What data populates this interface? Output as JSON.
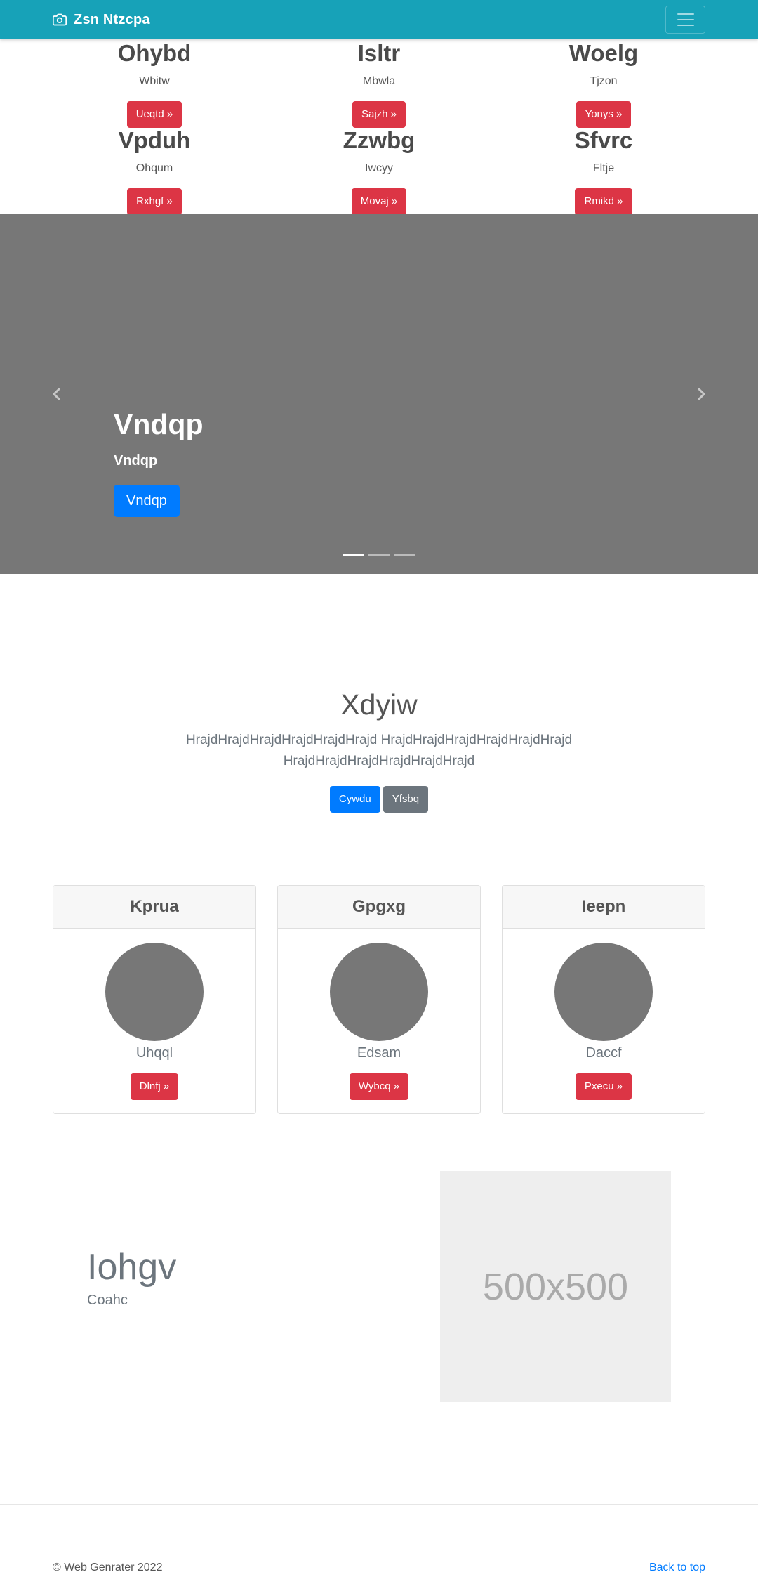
{
  "navbar": {
    "brand": "Zsn Ntzcpa"
  },
  "top_items": [
    [
      {
        "title": "Ohybd",
        "subtitle": "Wbitw",
        "button": "Ueqtd »"
      },
      {
        "title": "Isltr",
        "subtitle": "Mbwla",
        "button": "Sajzh »"
      },
      {
        "title": "Woelg",
        "subtitle": "Tjzon",
        "button": "Yonys »"
      }
    ],
    [
      {
        "title": "Vpduh",
        "subtitle": "Ohqum",
        "button": "Rxhgf »"
      },
      {
        "title": "Zzwbg",
        "subtitle": "Iwcyy",
        "button": "Movaj »"
      },
      {
        "title": "Sfvrc",
        "subtitle": "Fltje",
        "button": "Rmikd »"
      }
    ]
  ],
  "carousel": {
    "heading": "Vndqp",
    "subheading": "Vndqp",
    "button": "Vndqp",
    "slides": 3,
    "active_slide": 1
  },
  "jumbotron": {
    "title": "Xdyiw",
    "lead": "HrajdHrajdHrajdHrajdHrajdHrajd HrajdHrajdHrajdHrajdHrajdHrajd HrajdHrajdHrajdHrajdHrajdHrajd",
    "primary_button": "Cywdu",
    "secondary_button": "Yfsbq"
  },
  "cards": [
    {
      "header": "Kprua",
      "name": "Uhqql",
      "button": "Dlnfj »"
    },
    {
      "header": "Gpgxg",
      "name": "Edsam",
      "button": "Wybcq »"
    },
    {
      "header": "Ieepn",
      "name": "Daccf",
      "button": "Pxecu »"
    }
  ],
  "featurette": {
    "heading": "Iohgv",
    "subtext": "Coahc",
    "image_label": "500x500"
  },
  "footer": {
    "copyright": "© Web Genrater 2022",
    "back_to_top": "Back to top"
  },
  "colors": {
    "navbar": "#17a2b8",
    "danger": "#dc3545",
    "primary": "#007bff",
    "secondary": "#6c757d",
    "carousel_bg": "#777777"
  }
}
